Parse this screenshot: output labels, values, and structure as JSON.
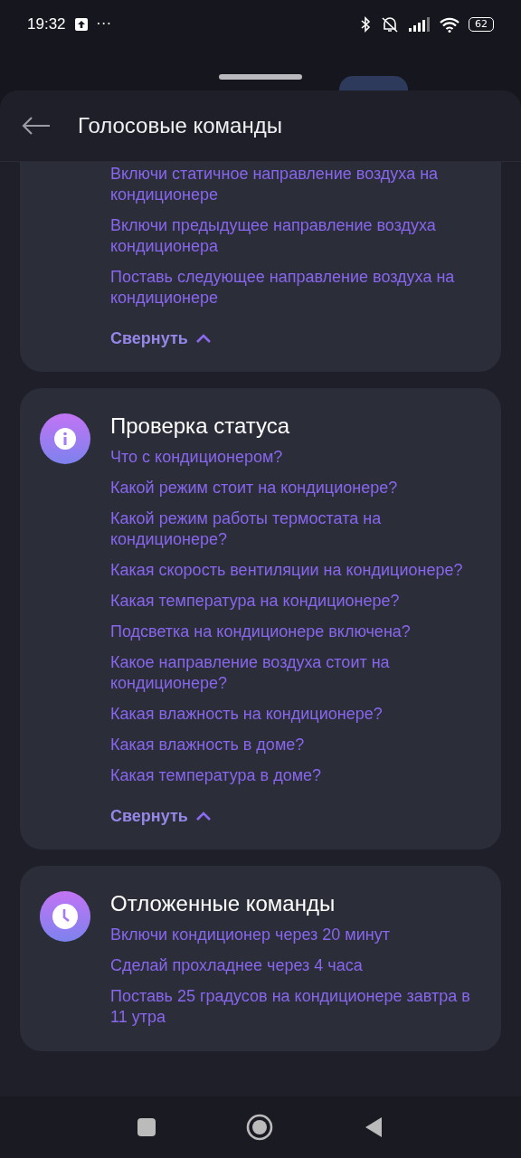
{
  "status_bar": {
    "time": "19:32",
    "more": "···",
    "battery": "62"
  },
  "header": {
    "title": "Голосовые команды"
  },
  "sections": [
    {
      "kind": "plain",
      "commands": [
        "Включи статичное направление воздуха на кондиционере",
        "Включи предыдущее направление воздуха кондиционера",
        "Поставь следующее направление воздуха на кондиционере"
      ],
      "collapse": "Свернуть"
    },
    {
      "kind": "status",
      "title": "Проверка статуса",
      "commands": [
        "Что с кондиционером?",
        "Какой режим стоит на кондиционере?",
        "Какой режим работы термостата на кондиционере?",
        "Какая скорость вентиляции на кондиционере?",
        "Какая температура на кондиционере?",
        "Подсветка на кондиционере включена?",
        "Какое направление воздуха стоит на кондиционере?",
        "Какая влажность на кондиционере?",
        "Какая влажность в доме?",
        "Какая температура в доме?"
      ],
      "collapse": "Свернуть"
    },
    {
      "kind": "delayed",
      "title": "Отложенные команды",
      "commands": [
        "Включи кондиционер через 20 минут",
        "Сделай прохладнее через 4 часа",
        "Поставь 25 градусов на кондиционере завтра в 11 утра"
      ]
    }
  ]
}
